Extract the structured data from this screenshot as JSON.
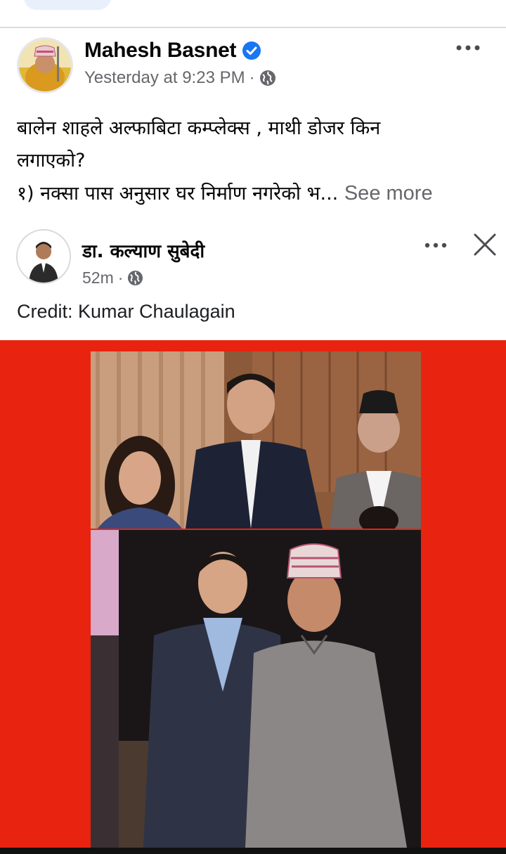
{
  "post": {
    "author": "Mahesh Basnet",
    "timestamp": "Yesterday at 9:23 PM",
    "text_lines": [
      "बालेन शाहले अल्फाबिटा कम्प्लेक्स , माथी डोजर किन",
      "लगाएको?",
      "१) नक्सा पास अनुसार घर निर्माण नगरेको भ..."
    ],
    "see_more": "See more"
  },
  "shared_post": {
    "author": "डा. कल्याण सुबेदी",
    "timestamp": "52m",
    "caption": "Credit: Kumar Chaulagain"
  },
  "colors": {
    "verified_badge": "#1877f2",
    "image_background": "#e8230f",
    "secondary_text": "#65676b"
  },
  "icons": {
    "verified": "verified-badge-icon",
    "privacy": "globe-icon",
    "more": "more-options-icon",
    "close": "close-icon"
  }
}
